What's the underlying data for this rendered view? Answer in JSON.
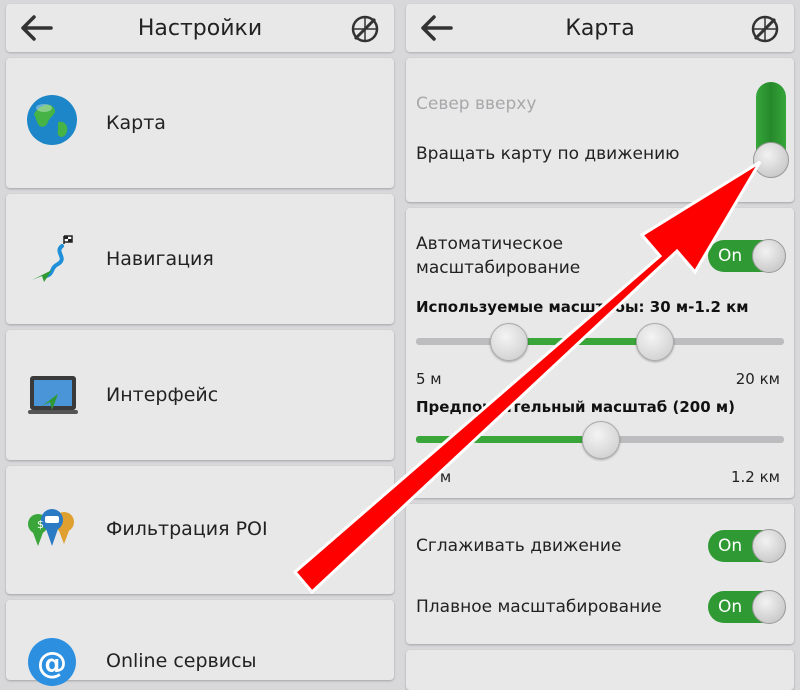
{
  "left": {
    "title": "Настройки",
    "menu": [
      {
        "label": "Карта",
        "icon": "globe-icon"
      },
      {
        "label": "Навигация",
        "icon": "route-flag-icon"
      },
      {
        "label": "Интерфейс",
        "icon": "monitor-icon"
      },
      {
        "label": "Фильтрация POI",
        "icon": "poi-pins-icon"
      },
      {
        "label": "Online сервисы",
        "icon": "at-icon"
      }
    ]
  },
  "right": {
    "title": "Карта",
    "orientation": {
      "north_up": "Север вверху",
      "rotate_map": "Вращать карту по движению"
    },
    "auto_scale": {
      "label": "Автоматическое масштабирование",
      "toggle": "On",
      "used_scales_label": "Используемые масштабы: 30 м-1.2 км",
      "used_scales_min": "5 м",
      "used_scales_max": "20 км",
      "preferred_label": "Предпочтительный масштаб (200 м)",
      "preferred_min": "10 м",
      "preferred_max": "1.2 км"
    },
    "smooth_motion": {
      "label": "Сглаживать движение",
      "toggle": "On"
    },
    "smooth_zoom": {
      "label": "Плавное масштабирование",
      "toggle": "On"
    }
  },
  "colors": {
    "accent": "#2f9a34",
    "arrow": "#ff0000",
    "background": "#d8d8da"
  }
}
